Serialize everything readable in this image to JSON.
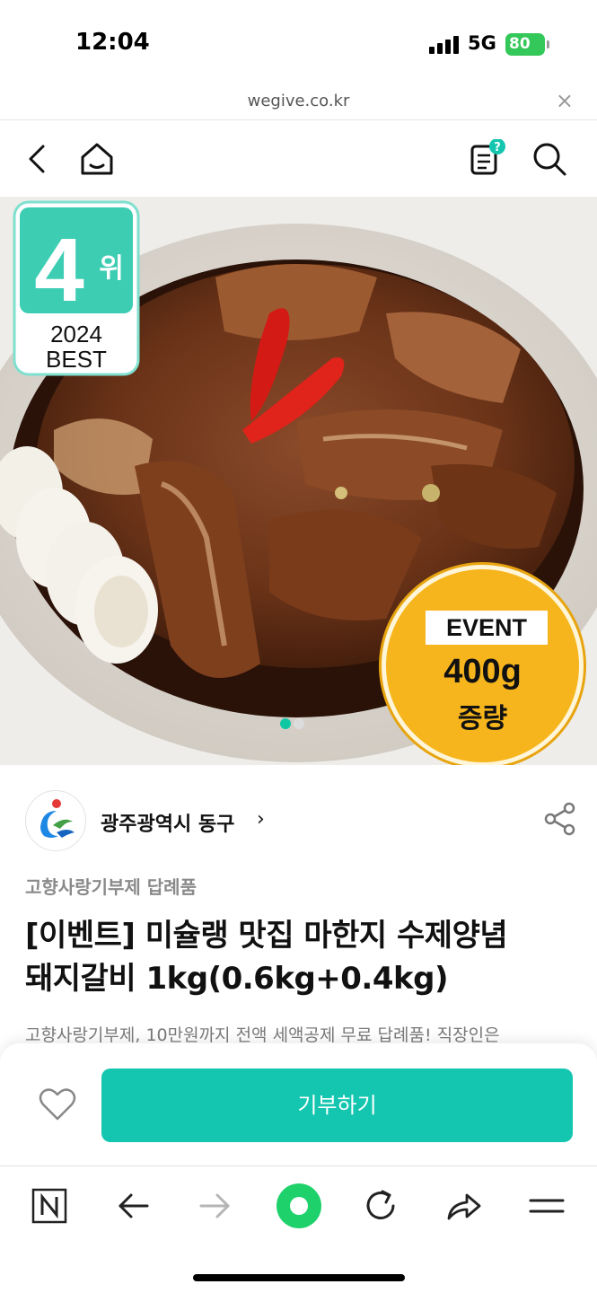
{
  "status_bar": {
    "time": "12:04",
    "network": "5G",
    "battery": "80"
  },
  "browser": {
    "url": "wegive.co.kr",
    "close_label": "×"
  },
  "header": {
    "icons": [
      "back-icon",
      "home-icon",
      "cart-help-icon",
      "search-icon"
    ],
    "help_badge": "?"
  },
  "hero": {
    "rank_number": "4",
    "rank_suffix": "위",
    "rank_year": "2024",
    "rank_label": "BEST",
    "event_tag": "EVENT",
    "event_amount": "400g",
    "event_sub": "증량",
    "slide_count": 2,
    "active_slide": 1
  },
  "seller": {
    "name": "광주광역시 동구",
    "chevron": "›"
  },
  "product": {
    "category": "고향사랑기부제 답례품",
    "title_line1": "[이벤트] 미슐랭 맛집 마한지 수제양념",
    "title_line2": "돼지갈비 1kg(0.6kg+0.4kg)",
    "description": "고향사랑기부제, 10만원까지 전액 세액공제 무료 답례품! 직장인은"
  },
  "cta": {
    "donate_label": "기부하기"
  },
  "toolbar": {
    "icons": [
      "naver-icon",
      "back-arrow-icon",
      "forward-arrow-icon",
      "green-dot-icon",
      "refresh-icon",
      "share-arrow-icon",
      "menu-icon"
    ]
  },
  "colors": {
    "accent": "#14c6b0",
    "event_badge": "#f6b51c",
    "rank_badge": "#3ccdb3"
  }
}
